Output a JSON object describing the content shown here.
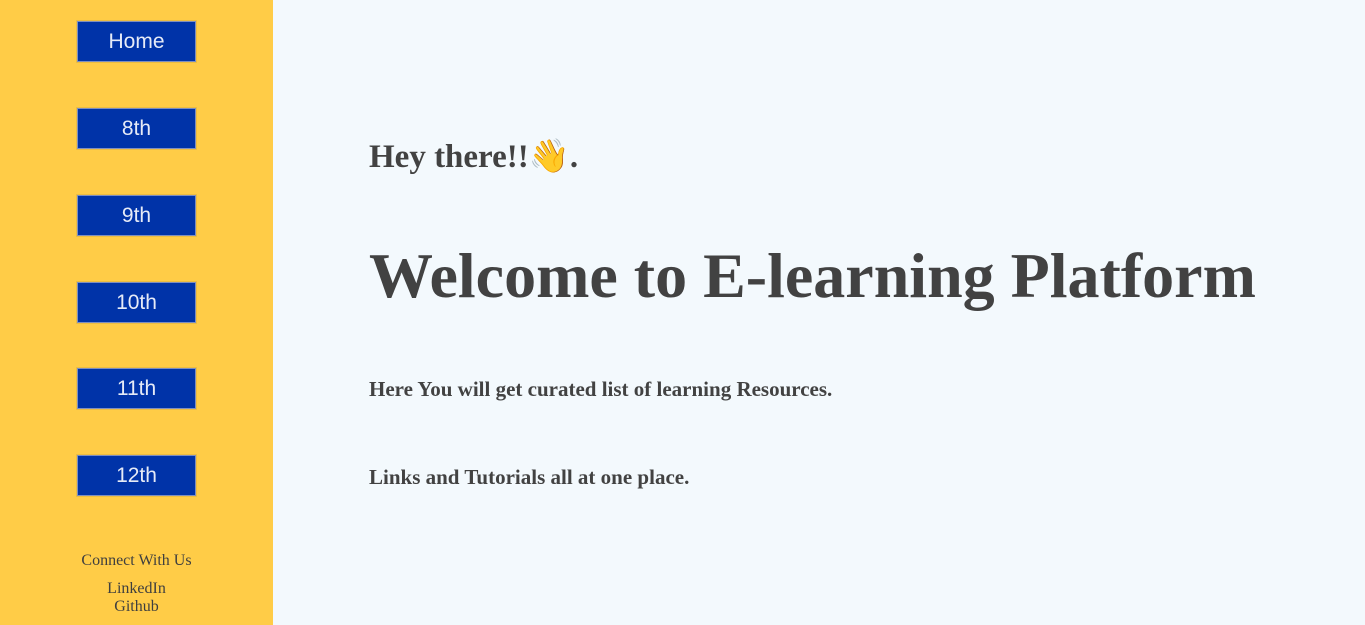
{
  "sidebar": {
    "nav": [
      {
        "label": "Home"
      },
      {
        "label": "8th"
      },
      {
        "label": "9th"
      },
      {
        "label": "10th"
      },
      {
        "label": "11th"
      },
      {
        "label": "12th"
      }
    ],
    "connect_title": "Connect With Us",
    "links": {
      "linkedin": "LinkedIn",
      "github": "Github"
    }
  },
  "main": {
    "greeting_text": "Hey there!!",
    "greeting_emoji": "👋",
    "greeting_end": ".",
    "title": "Welcome to E-learning Platform",
    "tagline_1": "Here You will get curated list of learning Resources.",
    "tagline_2": "Links and Tutorials all at one place."
  },
  "colors": {
    "sidebar_bg": "#ffcc47",
    "button_bg": "#0033a8",
    "page_bg": "#f3f9fd",
    "text": "#424242"
  }
}
